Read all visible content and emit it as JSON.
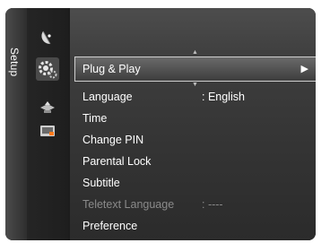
{
  "side_tab": {
    "label": "Setup"
  },
  "categories": [
    {
      "icon": "satellite-dish-icon"
    },
    {
      "icon": "gear-icon",
      "active": true
    },
    {
      "icon": "input-source-icon"
    },
    {
      "icon": "application-icon"
    }
  ],
  "menu": {
    "items": [
      {
        "label": "Plug & Play",
        "value": "",
        "selected": true
      },
      {
        "label": "Language",
        "value": ": English"
      },
      {
        "label": "Time",
        "value": ""
      },
      {
        "label": "Change PIN",
        "value": ""
      },
      {
        "label": "Parental Lock",
        "value": ""
      },
      {
        "label": "Subtitle",
        "value": ""
      },
      {
        "label": "Teletext Language",
        "value": ": ----",
        "disabled": true
      },
      {
        "label": "Preference",
        "value": ""
      }
    ],
    "scroll_up_glyph": "▲",
    "scroll_down_glyph": "▼",
    "submenu_arrow": "▶"
  },
  "colors": {
    "selected_border": "#cfcfcf",
    "disabled_text": "#8a8a8a"
  }
}
